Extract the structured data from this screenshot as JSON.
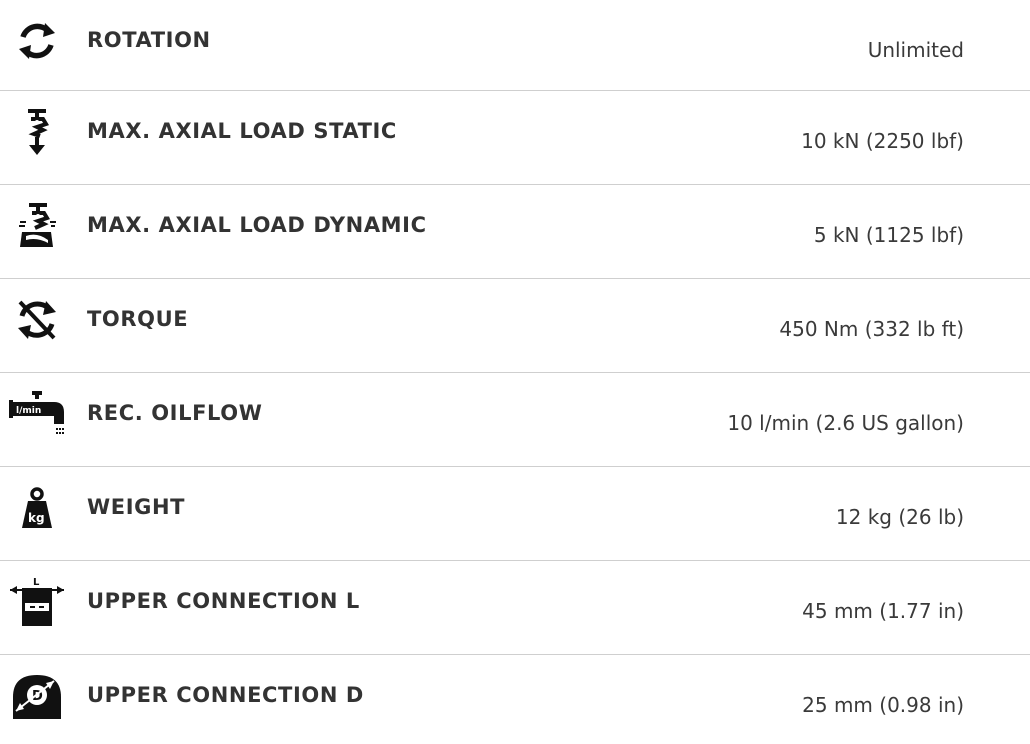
{
  "specs": [
    {
      "icon": "rotation-icon",
      "label": "ROTATION",
      "value": "Unlimited"
    },
    {
      "icon": "axial-load-static-icon",
      "label": "MAX. AXIAL LOAD STATIC",
      "value": "10 kN (2250 lbf)"
    },
    {
      "icon": "axial-load-dynamic-icon",
      "label": "MAX. AXIAL LOAD DYNAMIC",
      "value": "5 kN (1125 lbf)"
    },
    {
      "icon": "torque-icon",
      "label": "TORQUE",
      "value": "450 Nm (332 lb ft)"
    },
    {
      "icon": "oil-flow-tap-icon",
      "label": "REC. OILFLOW",
      "value": "10 l/min (2.6 US gallon)",
      "icon_text": "l/min"
    },
    {
      "icon": "weight-icon",
      "label": "WEIGHT",
      "value": "12 kg (26 lb)",
      "icon_text": "kg"
    },
    {
      "icon": "connection-length-icon",
      "label": "UPPER CONNECTION L",
      "value": "45 mm (1.77 in)",
      "icon_text": "L"
    },
    {
      "icon": "connection-diameter-icon",
      "label": "UPPER CONNECTION D",
      "value": "25 mm (0.98 in)",
      "icon_text": "D"
    }
  ]
}
